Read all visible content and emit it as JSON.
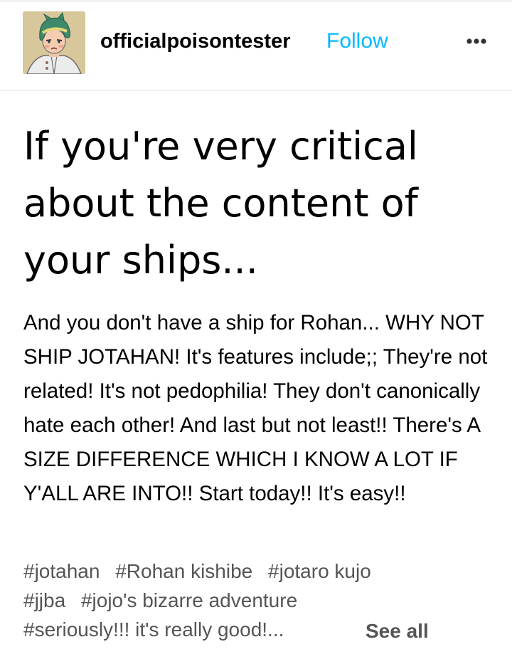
{
  "post": {
    "author": {
      "username": "officialpoisontester",
      "follow_label": "Follow",
      "avatar_icon": "anime-character-avatar",
      "more_icon": "more-options-icon"
    },
    "title": "If you're very critical about the content of your ships...",
    "body": "And you don't have a ship for Rohan... WHY NOT SHIP JOTAHAN!  It's features include;; They're not related!  It's not pedophilia!  They don't canonically hate each other!  And last but not least!! There's A SIZE DIFFERENCE WHICH I KNOW A LOT IF Y'ALL ARE INTO!! Start today!! It's easy!!",
    "tags": [
      "#jotahan",
      "#Rohan kishibe",
      "#jotaro kujo",
      "#jjba",
      "#jojo's bizarre adventure",
      "#seriously!!! it's really good!..."
    ],
    "see_all_label": "See all"
  },
  "colors": {
    "follow": "#00b8ff",
    "tags": "#555555",
    "text": "#000000"
  }
}
